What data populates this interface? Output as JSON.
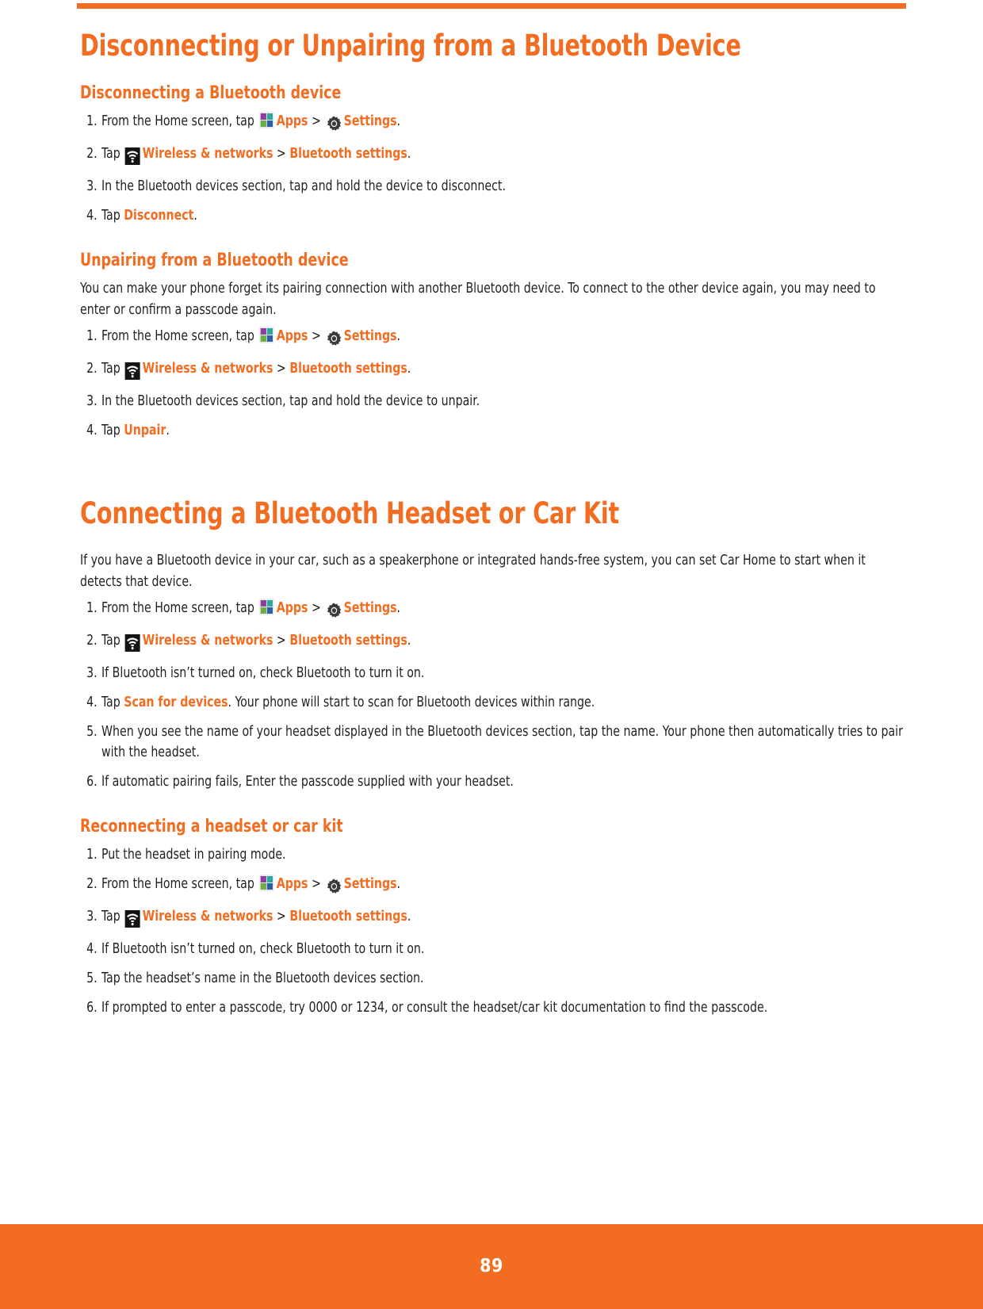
{
  "theme": {
    "accent": "#F26C21",
    "text": "#231f20",
    "footer_bg": "#F26C21",
    "footer_text": "#ffffff"
  },
  "icons": {
    "apps": "apps-grid-icon",
    "settings": "gear-icon",
    "wireless": "wifi-icon"
  },
  "sections": {
    "disconnect_unpair": {
      "title": "Disconnecting or Unpairing from a Bluetooth Device",
      "disconnecting": {
        "heading": "Disconnecting a Bluetooth device",
        "steps": [
          {
            "num": "1.",
            "pre": "From the Home screen, tap ",
            "icon1": "apps",
            "link1": "Apps",
            "sep": " > ",
            "icon2": "settings",
            "link2": "Settings",
            "post": "."
          },
          {
            "num": "2.",
            "pre": "Tap ",
            "icon1": "wireless",
            "link1": "Wireless & networks",
            "sep": " > ",
            "link2": "Bluetooth settings",
            "post": "."
          },
          {
            "num": "3.",
            "pre": "In the Bluetooth devices section, tap and hold the device to disconnect."
          },
          {
            "num": "4.",
            "pre": "Tap ",
            "link1": "Disconnect",
            "post": "."
          }
        ]
      },
      "unpairing": {
        "heading": "Unpairing from a Bluetooth device",
        "intro": "You can make your phone forget its pairing connection with another Bluetooth device. To connect to the other device again, you may need to enter or confirm a passcode again.",
        "steps": [
          {
            "num": "1.",
            "pre": "From the Home screen, tap ",
            "icon1": "apps",
            "link1": "Apps",
            "sep": " > ",
            "icon2": "settings",
            "link2": "Settings",
            "post": "."
          },
          {
            "num": "2.",
            "pre": "Tap ",
            "icon1": "wireless",
            "link1": "Wireless & networks",
            "sep": " > ",
            "link2": "Bluetooth settings",
            "post": "."
          },
          {
            "num": "3.",
            "pre": "In the Bluetooth devices section, tap and hold the device to unpair."
          },
          {
            "num": "4.",
            "pre": "Tap ",
            "link1": "Unpair",
            "post": "."
          }
        ]
      }
    },
    "connecting_headset": {
      "title": "Connecting a Bluetooth Headset or Car Kit",
      "intro": "If you have a Bluetooth device in your car, such as a speakerphone or integrated hands-free system, you can set Car Home to start when it detects that device.",
      "steps": [
        {
          "num": "1.",
          "pre": "From the Home screen, tap ",
          "icon1": "apps",
          "link1": "Apps",
          "sep": " > ",
          "icon2": "settings",
          "link2": "Settings",
          "post": "."
        },
        {
          "num": "2.",
          "pre": "Tap ",
          "icon1": "wireless",
          "link1": "Wireless & networks",
          "sep": " > ",
          "link2": "Bluetooth settings",
          "post": "."
        },
        {
          "num": "3.",
          "pre": "If Bluetooth isn’t turned on, check Bluetooth to turn it on."
        },
        {
          "num": "4.",
          "pre": "Tap ",
          "link1": "Scan for devices",
          "post": ". Your phone will start to scan for Bluetooth devices within range."
        },
        {
          "num": "5.",
          "pre": "When you see the name of your headset displayed in the Bluetooth devices section, tap the name. Your phone then automatically tries to pair with the headset."
        },
        {
          "num": "6.",
          "pre": "If automatic pairing fails, Enter the passcode supplied with your headset."
        }
      ],
      "reconnecting": {
        "heading": "Reconnecting a headset or car kit",
        "steps": [
          {
            "num": "1.",
            "pre": "Put the headset in pairing mode."
          },
          {
            "num": "2.",
            "pre": "From the Home screen, tap ",
            "icon1": "apps",
            "link1": "Apps",
            "sep": " > ",
            "icon2": "settings",
            "link2": "Settings",
            "post": "."
          },
          {
            "num": "3.",
            "pre": "Tap ",
            "icon1": "wireless",
            "link1": "Wireless & networks",
            "sep": " > ",
            "link2": "Bluetooth settings",
            "post": "."
          },
          {
            "num": "4.",
            "pre": "If Bluetooth isn’t turned on, check Bluetooth to turn it on."
          },
          {
            "num": "5.",
            "pre": "Tap the headset’s name in the Bluetooth devices section."
          },
          {
            "num": "6.",
            "pre": "If prompted to enter a passcode, try 0000 or 1234, or consult the headset/car kit documentation to find the passcode."
          }
        ]
      }
    }
  },
  "footer": {
    "page_number": "89"
  }
}
